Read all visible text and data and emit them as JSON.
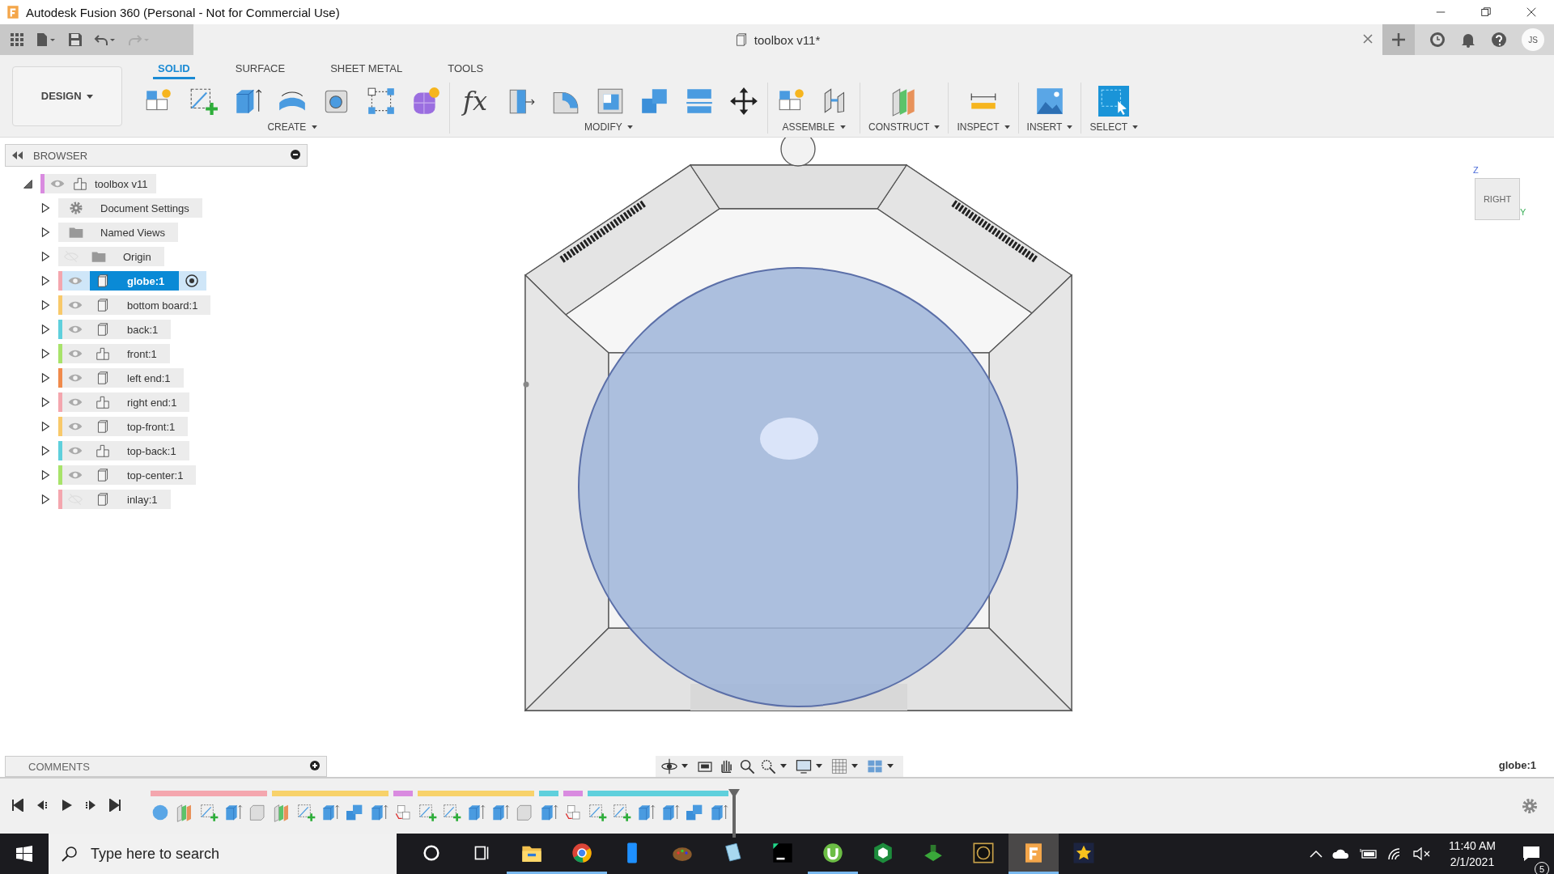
{
  "window": {
    "title": "Autodesk Fusion 360 (Personal - Not for Commercial Use)"
  },
  "document_tab": {
    "title": "toolbox v11*"
  },
  "account": {
    "initials": "JS"
  },
  "workspace": {
    "label": "DESIGN"
  },
  "ribbon_tabs": [
    {
      "label": "SOLID",
      "selected": true
    },
    {
      "label": "SURFACE",
      "selected": false
    },
    {
      "label": "SHEET METAL",
      "selected": false
    },
    {
      "label": "TOOLS",
      "selected": false
    }
  ],
  "tool_groups": [
    {
      "label": "CREATE",
      "tools": [
        {
          "kind": "new-component"
        },
        {
          "kind": "sketch"
        },
        {
          "kind": "extrude"
        },
        {
          "kind": "revolve"
        },
        {
          "kind": "hole"
        },
        {
          "kind": "pattern"
        },
        {
          "kind": "form"
        }
      ]
    },
    {
      "label": "MODIFY",
      "tools": [
        {
          "kind": "glyph",
          "glyph": "fx"
        },
        {
          "kind": "press-pull"
        },
        {
          "kind": "fillet"
        },
        {
          "kind": "shell"
        },
        {
          "kind": "combine"
        },
        {
          "kind": "split"
        },
        {
          "kind": "move"
        }
      ]
    },
    {
      "label": "ASSEMBLE",
      "tools": [
        {
          "kind": "new-component"
        },
        {
          "kind": "joint"
        }
      ]
    },
    {
      "label": "CONSTRUCT",
      "tools": [
        {
          "kind": "plane"
        }
      ]
    },
    {
      "label": "INSPECT",
      "tools": [
        {
          "kind": "measure"
        }
      ]
    },
    {
      "label": "INSERT",
      "tools": [
        {
          "kind": "image"
        }
      ]
    },
    {
      "label": "SELECT",
      "tools": [
        {
          "kind": "select"
        }
      ]
    }
  ],
  "browser": {
    "title": "BROWSER",
    "root": {
      "label": "toolbox v11",
      "kind": "component",
      "color": "#d98be0",
      "visible": true,
      "expanded": true,
      "selected": false,
      "children": [
        {
          "label": "Document Settings",
          "kind": "gear",
          "expanded": false,
          "selected": false
        },
        {
          "label": "Named Views",
          "kind": "folder",
          "expanded": false,
          "selected": false
        },
        {
          "label": "Origin",
          "kind": "folder",
          "visible": false,
          "expanded": false,
          "selected": false
        },
        {
          "label": "globe:1",
          "kind": "body",
          "color": "#f4a6ae",
          "visible": true,
          "expanded": false,
          "selected": true
        },
        {
          "label": "bottom board:1",
          "kind": "body",
          "color": "#f8c96a",
          "visible": true,
          "expanded": false,
          "selected": false
        },
        {
          "label": "back:1",
          "kind": "body",
          "color": "#5fd0dc",
          "visible": true,
          "expanded": false,
          "selected": false
        },
        {
          "label": "front:1",
          "kind": "component",
          "color": "#a8e36a",
          "visible": true,
          "expanded": false,
          "selected": false
        },
        {
          "label": "left end:1",
          "kind": "body",
          "color": "#f08a4b",
          "visible": true,
          "expanded": false,
          "selected": false
        },
        {
          "label": "right end:1",
          "kind": "component",
          "color": "#f4a6ae",
          "visible": true,
          "expanded": false,
          "selected": false
        },
        {
          "label": "top-front:1",
          "kind": "body",
          "color": "#f8c96a",
          "visible": true,
          "expanded": false,
          "selected": false
        },
        {
          "label": "top-back:1",
          "kind": "component",
          "color": "#5fd0dc",
          "visible": true,
          "expanded": false,
          "selected": false
        },
        {
          "label": "top-center:1",
          "kind": "body",
          "color": "#a8e36a",
          "visible": true,
          "expanded": false,
          "selected": false
        },
        {
          "label": "inlay:1",
          "kind": "body",
          "color": "#f4a6ae",
          "visible": false,
          "expanded": false,
          "selected": false
        }
      ]
    }
  },
  "viewcube": {
    "face": "RIGHT",
    "axis_labels": [
      "Z",
      "Y"
    ]
  },
  "comments": {
    "title": "COMMENTS"
  },
  "status": {
    "selection": "globe:1"
  },
  "timeline": {
    "groups": [
      {
        "color": "#f4a6ae",
        "items": [
          {
            "kind": "sphere"
          },
          {
            "kind": "plane"
          },
          {
            "kind": "sketch"
          },
          {
            "kind": "extrude"
          },
          {
            "kind": "box"
          }
        ]
      },
      {
        "color": "#f8d26a",
        "items": [
          {
            "kind": "plane"
          },
          {
            "kind": "sketch"
          },
          {
            "kind": "extrude"
          },
          {
            "kind": "combine"
          },
          {
            "kind": "extrude"
          }
        ]
      },
      {
        "color": "#d98be0",
        "items": [
          {
            "kind": "joint-link"
          }
        ]
      },
      {
        "color": "#f8d26a",
        "items": [
          {
            "kind": "sketch"
          },
          {
            "kind": "sketch"
          },
          {
            "kind": "extrude"
          },
          {
            "kind": "extrude"
          },
          {
            "kind": "box"
          }
        ]
      },
      {
        "color": "#5fd0dc",
        "items": [
          {
            "kind": "extrude"
          }
        ]
      },
      {
        "color": "#d98be0",
        "items": [
          {
            "kind": "joint-link"
          }
        ]
      },
      {
        "color": "#5fd0dc",
        "items": [
          {
            "kind": "sketch"
          },
          {
            "kind": "sketch"
          },
          {
            "kind": "extrude"
          },
          {
            "kind": "extrude"
          },
          {
            "kind": "combine"
          },
          {
            "kind": "extrude"
          }
        ]
      }
    ]
  },
  "taskbar": {
    "search_placeholder": "Type here to search",
    "apps": [
      {
        "kind": "cortana",
        "running": false,
        "selected": false
      },
      {
        "kind": "task-view",
        "running": false,
        "selected": false
      },
      {
        "kind": "explorer",
        "running": true,
        "selected": false
      },
      {
        "kind": "chrome",
        "running": true,
        "selected": false
      },
      {
        "kind": "phone",
        "running": false,
        "selected": false
      },
      {
        "kind": "paint",
        "running": false,
        "selected": false
      },
      {
        "kind": "notepad",
        "running": false,
        "selected": false
      },
      {
        "kind": "ide",
        "running": false,
        "selected": false
      },
      {
        "kind": "torrent",
        "running": true,
        "selected": false
      },
      {
        "kind": "slicer",
        "running": false,
        "selected": false
      },
      {
        "kind": "printer",
        "running": false,
        "selected": false
      },
      {
        "kind": "ring",
        "running": false,
        "selected": false
      },
      {
        "kind": "fusion",
        "running": true,
        "selected": true
      },
      {
        "kind": "star",
        "running": false,
        "selected": false
      }
    ],
    "time": "11:40 AM",
    "date": "2/1/2021",
    "notifications": "5"
  }
}
